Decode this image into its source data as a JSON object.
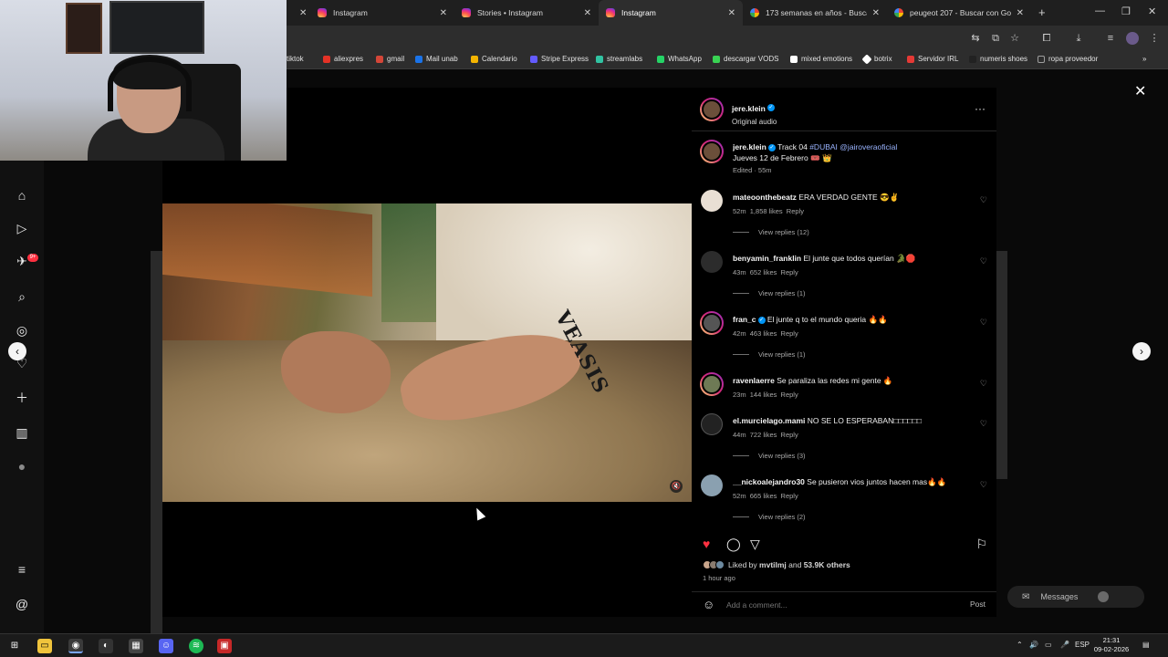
{
  "browser": {
    "tabs": [
      {
        "label": "Instagram",
        "favicon": "instagram-icon",
        "active": false
      },
      {
        "label": "Stories • Instagram",
        "favicon": "instagram-icon",
        "active": false
      },
      {
        "label": "Instagram",
        "favicon": "instagram-icon",
        "active": true
      },
      {
        "label": "173 semanas en años - Buscar",
        "favicon": "google-icon",
        "active": false
      },
      {
        "label": "peugeot 207 - Buscar con Goo",
        "favicon": "google-icon",
        "active": false
      }
    ],
    "bookmarks": [
      {
        "label": "tiktok",
        "color": "#111111"
      },
      {
        "label": "aliexpres",
        "color": "#e43226"
      },
      {
        "label": "gmail",
        "color": "#d44638"
      },
      {
        "label": "Mail unab",
        "color": "#1a73e8"
      },
      {
        "label": "Calendario",
        "color": "#f4b400"
      },
      {
        "label": "Stripe Express",
        "color": "#635bff"
      },
      {
        "label": "streamlabs",
        "color": "#31c3a2"
      },
      {
        "label": "WhatsApp",
        "color": "#25d366"
      },
      {
        "label": "descargar VODS",
        "color": "#39d353"
      },
      {
        "label": "mixed emotions",
        "color": "#ffffff"
      },
      {
        "label": "botrix",
        "color": "#ffffff"
      },
      {
        "label": "Servidor IRL",
        "color": "#e53935"
      },
      {
        "label": "numeris shoes",
        "color": "#222222"
      },
      {
        "label": "ropa proveedor",
        "color": "#9e9e9e"
      }
    ]
  },
  "ig_nav": {
    "icons": [
      "home-icon",
      "reels-icon",
      "send-icon",
      "search-icon",
      "explore-icon",
      "heart-icon",
      "create-icon",
      "insights-icon",
      "profile-icon"
    ],
    "notification_badge": "9+",
    "bottom_icons": [
      "menu-icon",
      "threads-icon"
    ]
  },
  "post": {
    "author": "jere.klein",
    "audio": "Original audio",
    "caption": {
      "username": "jere.klein",
      "text": "Track 04 ",
      "hashtag": "#DUBAI",
      "mention": "@jairoveraoficial",
      "line2": "Jueves 12 de Febrero 🎟️ 👑",
      "meta": "Edited · 55m"
    },
    "comments": [
      {
        "username": "mateoonthebeatz",
        "verified": false,
        "text": "ERA VERDAD GENTE 😎✌️",
        "time": "52m",
        "likes": "1,858 likes",
        "reply": "Reply",
        "view_replies": "View replies (12)"
      },
      {
        "username": "benyamin_franklin",
        "verified": false,
        "text": "El junte que todos querían 🐊🛑",
        "time": "43m",
        "likes": "652 likes",
        "reply": "Reply",
        "view_replies": "View replies (1)"
      },
      {
        "username": "fran_c",
        "verified": true,
        "text": "El junte q to el mundo queria 🔥🔥",
        "time": "42m",
        "likes": "463 likes",
        "reply": "Reply",
        "view_replies": "View replies (1)"
      },
      {
        "username": "ravenlaerre",
        "verified": false,
        "text": "Se paraliza las redes mi gente 🔥",
        "time": "23m",
        "likes": "144 likes",
        "reply": "Reply",
        "view_replies": ""
      },
      {
        "username": "el.murcielago.mami",
        "verified": false,
        "text": "NO SE LO ESPERABAN□□□□□□",
        "time": "44m",
        "likes": "722 likes",
        "reply": "Reply",
        "view_replies": "View replies (3)"
      },
      {
        "username": "__nickoalejandro30",
        "verified": false,
        "text": "Se pusieron vios juntos hacen mas🔥🔥",
        "time": "52m",
        "likes": "665 likes",
        "reply": "Reply",
        "view_replies": "View replies (2)"
      }
    ],
    "liked_by_prefix": "Liked by ",
    "liked_by_user": "mvtilmj",
    "liked_by_and": " and ",
    "liked_by_others": "53.9K others",
    "posted": "1 hour ago",
    "comment_placeholder": "Add a comment...",
    "post_button": "Post",
    "video_tattoo": "VEASIS"
  },
  "messages_label": "Messages",
  "taskbar": {
    "language": "ESP",
    "time": "21:31",
    "date": "09-02-2026"
  }
}
